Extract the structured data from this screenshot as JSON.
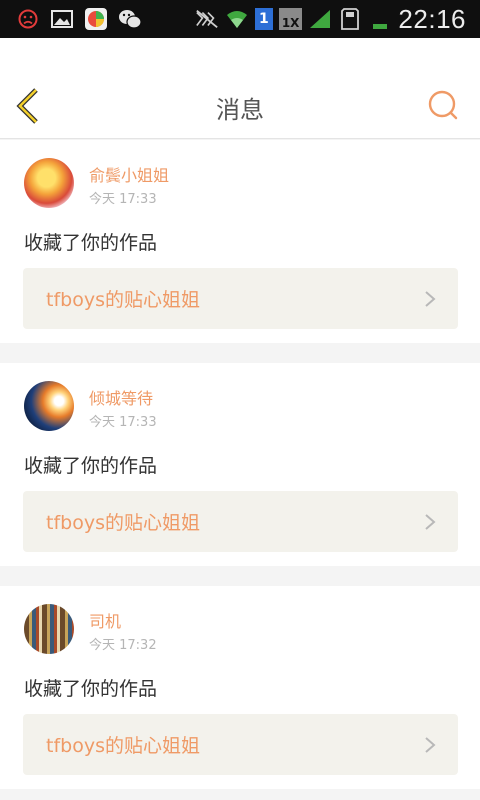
{
  "status_bar": {
    "time": "22:16",
    "badge_sim": "1",
    "badge_speed": "1X",
    "icons": [
      "sad-face-icon",
      "gallery-icon",
      "game-app-icon",
      "wechat-icon",
      "mute-icon",
      "wifi-icon",
      "signal-icon",
      "sdcard-icon",
      "battery-icon"
    ]
  },
  "header": {
    "title": "消息",
    "back_icon": "chevron-left-icon",
    "search_icon": "search-icon",
    "accent_color": "#ef9a66",
    "back_color": "#f2cf2b"
  },
  "messages": [
    {
      "user": "俞鬓小姐姐",
      "time": "今天 17:33",
      "action": "收藏了你的作品",
      "work": "tfboys的贴心姐姐"
    },
    {
      "user": "倾城等待",
      "time": "今天 17:33",
      "action": "收藏了你的作品",
      "work": "tfboys的贴心姐姐"
    },
    {
      "user": "司机",
      "time": "今天 17:32",
      "action": "收藏了你的作品",
      "work": "tfboys的贴心姐姐"
    }
  ]
}
